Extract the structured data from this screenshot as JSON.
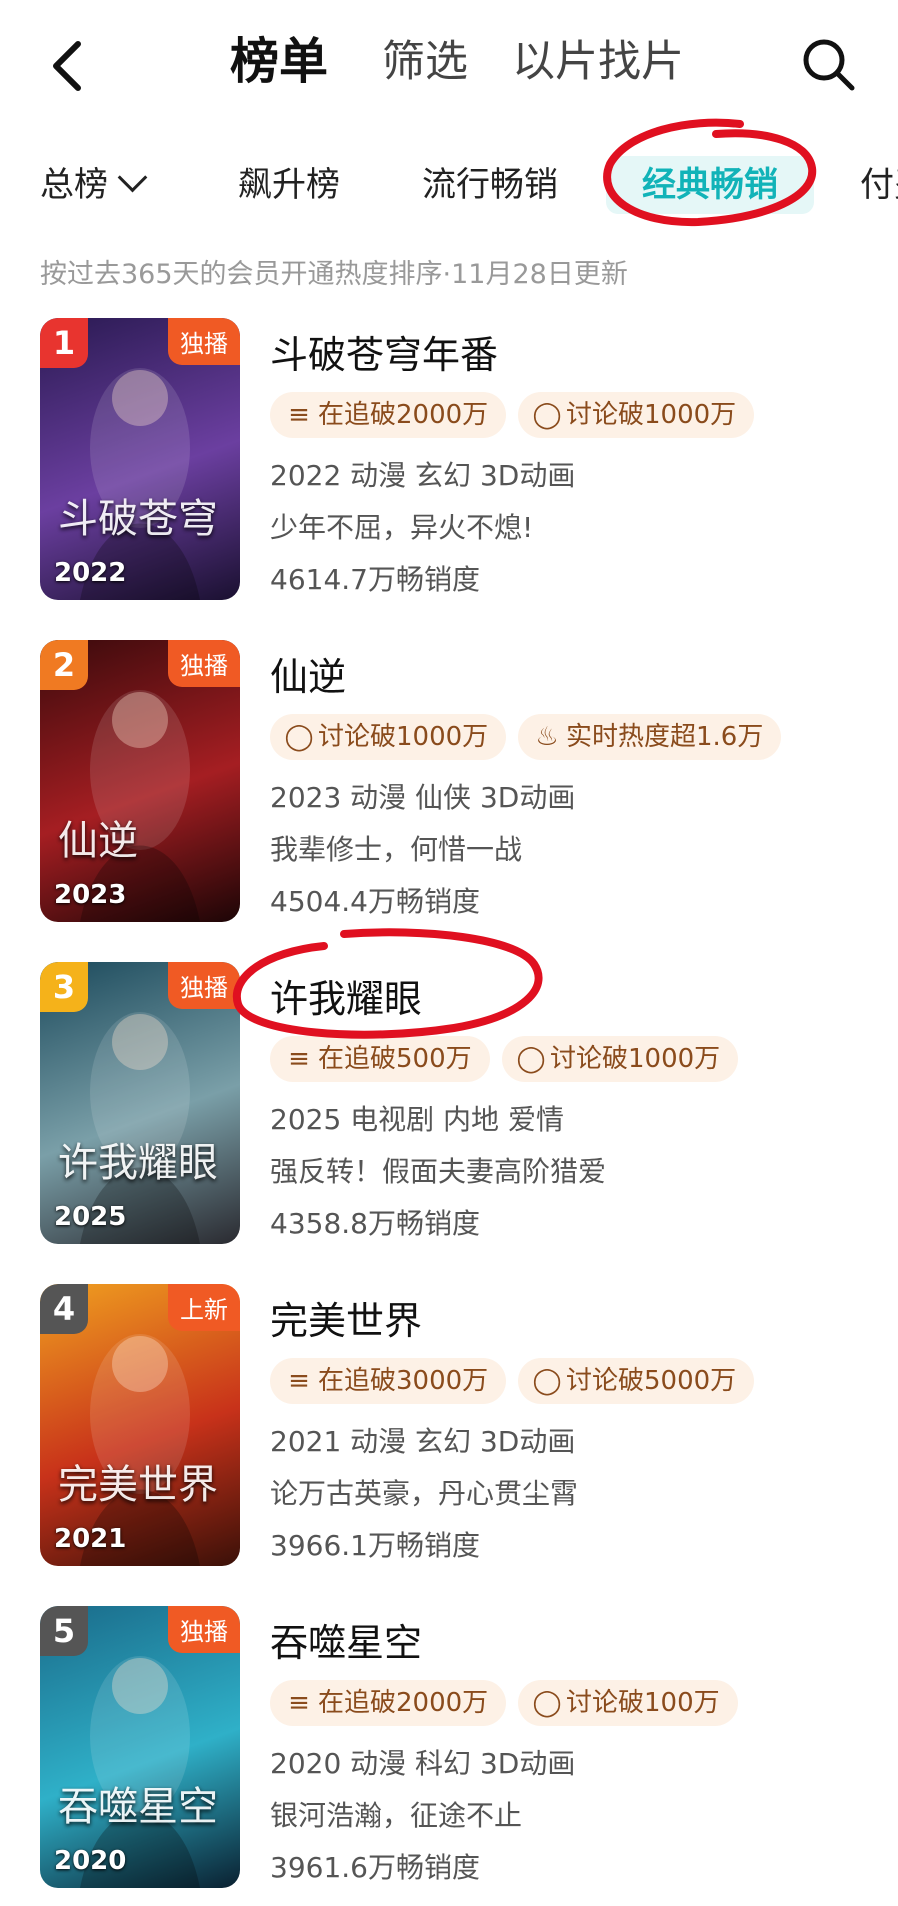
{
  "header": {
    "tabs": [
      "榜单",
      "筛选",
      "以片找片"
    ]
  },
  "subtabs": [
    "总榜",
    "飙升榜",
    "流行畅销",
    "经典畅销",
    "付费"
  ],
  "notice": "按过去365天的会员开通热度排序·11月28日更新",
  "items": [
    {
      "rank": "1",
      "badge": "独播",
      "year": "2022",
      "poster_text": "斗破苍穹",
      "title": "斗破苍穹年番",
      "tags": [
        {
          "icon": "follow-icon",
          "glyph": "≡",
          "text": "在追破2000万"
        },
        {
          "icon": "comment-icon",
          "glyph": "◯",
          "text": "讨论破1000万"
        }
      ],
      "meta": "2022 动漫 玄幻 3D动画",
      "desc": "少年不屈，异火不熄!",
      "sales": "4614.7万畅销度",
      "colors": [
        "#2a1a52",
        "#6b3fa0",
        "#1a1030"
      ],
      "rank_color": "#e8342f"
    },
    {
      "rank": "2",
      "badge": "独播",
      "year": "2023",
      "poster_text": "仙逆",
      "title": "仙逆",
      "tags": [
        {
          "icon": "comment-icon",
          "glyph": "◯",
          "text": "讨论破1000万"
        },
        {
          "icon": "fire-icon",
          "glyph": "♨",
          "text": "实时热度超1.6万"
        }
      ],
      "meta": "2023 动漫 仙侠 3D动画",
      "desc": "我辈修士，何惜一战",
      "sales": "4504.4万畅销度",
      "colors": [
        "#3a0a0c",
        "#a51e22",
        "#1c0506"
      ],
      "rank_color": "#f07a22"
    },
    {
      "rank": "3",
      "badge": "独播",
      "year": "2025",
      "poster_text": "许我耀眼",
      "title": "许我耀眼",
      "tags": [
        {
          "icon": "follow-icon",
          "glyph": "≡",
          "text": "在追破500万"
        },
        {
          "icon": "comment-icon",
          "glyph": "◯",
          "text": "讨论破1000万"
        }
      ],
      "meta": "2025 电视剧 内地 爱情",
      "desc": "强反转！假面夫妻高阶猎爱",
      "sales": "4358.8万畅销度",
      "colors": [
        "#1c4a5c",
        "#7a9fa8",
        "#2a2a30"
      ],
      "rank_color": "#f5b21a"
    },
    {
      "rank": "4",
      "badge": "上新",
      "year": "2021",
      "poster_text": "完美世界",
      "title": "完美世界",
      "tags": [
        {
          "icon": "follow-icon",
          "glyph": "≡",
          "text": "在追破3000万"
        },
        {
          "icon": "comment-icon",
          "glyph": "◯",
          "text": "讨论破5000万"
        }
      ],
      "meta": "2021 动漫 玄幻 3D动画",
      "desc": "论万古英豪，丹心贯尘霄",
      "sales": "3966.1万畅销度",
      "colors": [
        "#f0a020",
        "#c8321a",
        "#3a1008"
      ],
      "rank_color": "#555555"
    },
    {
      "rank": "5",
      "badge": "独播",
      "year": "2020",
      "poster_text": "吞噬星空",
      "title": "吞噬星空",
      "tags": [
        {
          "icon": "follow-icon",
          "glyph": "≡",
          "text": "在追破2000万"
        },
        {
          "icon": "comment-icon",
          "glyph": "◯",
          "text": "讨论破100万"
        }
      ],
      "meta": "2020 动漫 科幻 3D动画",
      "desc": "银河浩瀚，征途不止",
      "sales": "3961.6万畅销度",
      "colors": [
        "#1a6b8a",
        "#2fb0c8",
        "#0a2030"
      ],
      "rank_color": "#555555"
    }
  ],
  "theme": {
    "accent": "#11b3b8",
    "badge": "#f05a24",
    "tag_bg": "#fdf1e6",
    "tag_text": "#8a4b1c",
    "scribble": "#e01020"
  }
}
